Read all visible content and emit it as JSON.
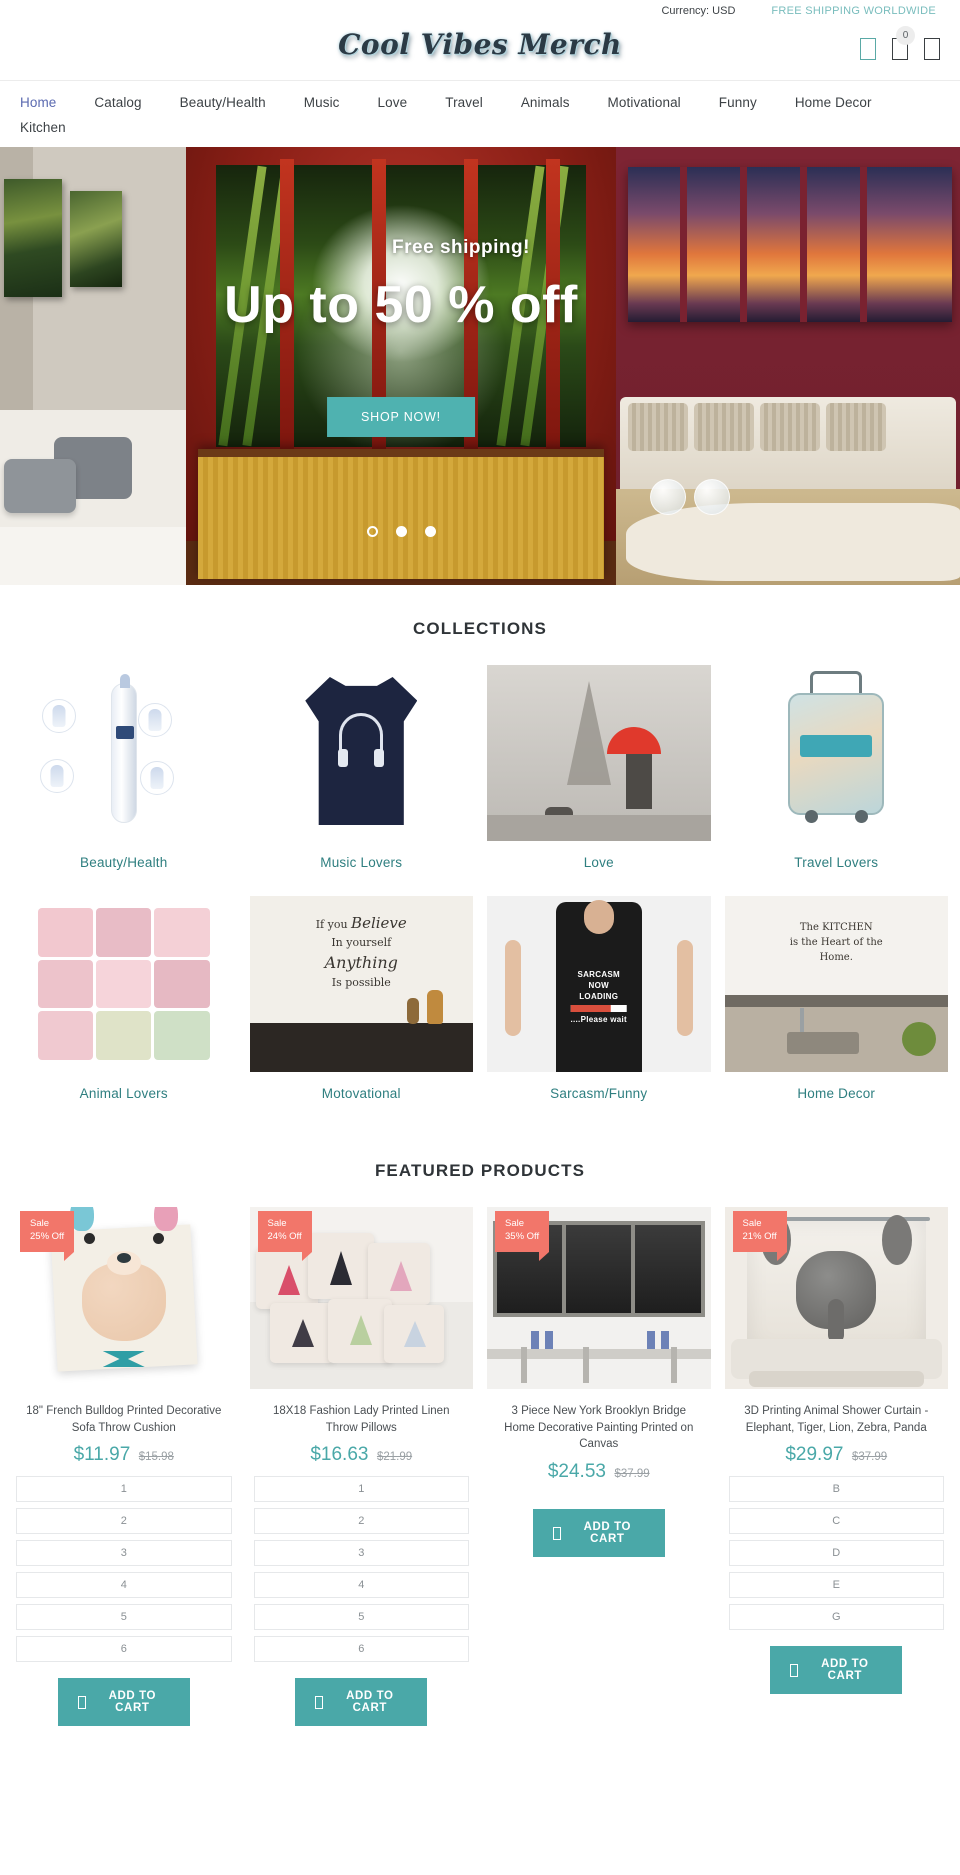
{
  "topbar": {
    "currency_label": "Currency: USD",
    "shipping_label": "FREE SHIPPING WORLDWIDE"
  },
  "header": {
    "logo_text": "Cool Vibes Merch",
    "icons": [
      {
        "name": "search-icon",
        "glyph": "▯"
      },
      {
        "name": "cart-icon",
        "glyph": "▯"
      },
      {
        "name": "account-icon",
        "glyph": "▯"
      }
    ],
    "cart_count": "0"
  },
  "nav": {
    "items": [
      {
        "label": "Home",
        "active": true
      },
      {
        "label": "Catalog",
        "active": false
      },
      {
        "label": "Beauty/Health",
        "active": false
      },
      {
        "label": "Music",
        "active": false
      },
      {
        "label": "Love",
        "active": false
      },
      {
        "label": "Travel",
        "active": false
      },
      {
        "label": "Animals",
        "active": false
      },
      {
        "label": "Motivational",
        "active": false
      },
      {
        "label": "Funny",
        "active": false
      },
      {
        "label": "Home Decor",
        "active": false
      },
      {
        "label": "Kitchen",
        "active": false
      }
    ]
  },
  "hero": {
    "subtitle": "Free shipping!",
    "title": "Up to 50 % off",
    "cta_label": "SHOP NOW!",
    "slide_count": 3,
    "active_slide": 1,
    "accent_color": "#4fb2b0"
  },
  "collections": {
    "title": "COLLECTIONS",
    "items": [
      {
        "label": "Beauty/Health"
      },
      {
        "label": "Music Lovers"
      },
      {
        "label": "Love"
      },
      {
        "label": "Travel Lovers"
      },
      {
        "label": "Animal Lovers"
      },
      {
        "label": "Motovational"
      },
      {
        "label": "Sarcasm/Funny"
      },
      {
        "label": "Home Decor"
      }
    ],
    "link_color": "#2f7f80"
  },
  "featured": {
    "title": "FEATURED PRODUCTS",
    "add_to_cart_label": "ADD TO CART",
    "badge_color": "#f2766a",
    "price_color": "#4aa8a8",
    "products": [
      {
        "badge_line1": "Sale",
        "badge_line2": "25% Off",
        "title": "18\" French Bulldog Printed Decorative Sofa Throw Cushion",
        "price": "$11.97",
        "compare_at": "$15.98",
        "variants": [
          "1",
          "2",
          "3",
          "4",
          "5",
          "6"
        ]
      },
      {
        "badge_line1": "Sale",
        "badge_line2": "24% Off",
        "title": "18X18 Fashion Lady Printed Linen Throw Pillows",
        "price": "$16.63",
        "compare_at": "$21.99",
        "variants": [
          "1",
          "2",
          "3",
          "4",
          "5",
          "6"
        ]
      },
      {
        "badge_line1": "Sale",
        "badge_line2": "35% Off",
        "title": "3 Piece New York Brooklyn Bridge Home Decorative Painting Printed on Canvas",
        "price": "$24.53",
        "compare_at": "$37.99",
        "variants": []
      },
      {
        "badge_line1": "Sale",
        "badge_line2": "21% Off",
        "title": "3D Printing Animal Shower Curtain - Elephant, Tiger, Lion, Zebra, Panda",
        "price": "$29.97",
        "compare_at": "$37.99",
        "variants": [
          "B",
          "C",
          "D",
          "E",
          "G"
        ]
      }
    ]
  },
  "art_text": {
    "motivational_l1": "If you",
    "motivational_l2": "Believe",
    "motivational_l3": "In yourself",
    "motivational_l4": "Anything",
    "motivational_l5": "Is possible",
    "sarcasm_l1": "SARCASM",
    "sarcasm_l2": "NOW",
    "sarcasm_l3": "LOADING",
    "sarcasm_pct": "73%",
    "sarcasm_wait": "....Please wait",
    "kitchen_l1": "The KITCHEN",
    "kitchen_l2": "is the Heart of the",
    "kitchen_l3": "Home."
  }
}
